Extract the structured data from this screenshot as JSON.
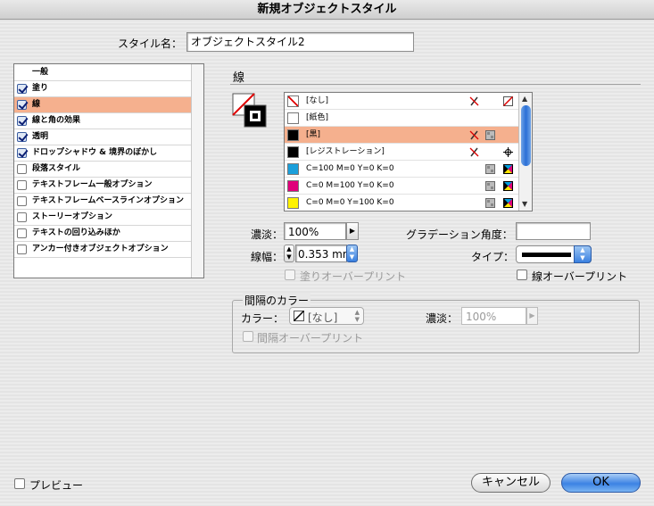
{
  "window": {
    "title": "新規オブジェクトスタイル"
  },
  "style_name": {
    "label": "スタイル名：",
    "value": "オブジェクトスタイル2"
  },
  "sidebar": {
    "items": [
      {
        "label": "一般",
        "checkbox": false,
        "checked": false,
        "selected": false
      },
      {
        "label": "塗り",
        "checkbox": true,
        "checked": true,
        "selected": false
      },
      {
        "label": "線",
        "checkbox": true,
        "checked": true,
        "selected": true
      },
      {
        "label": "線と角の効果",
        "checkbox": true,
        "checked": true,
        "selected": false
      },
      {
        "label": "透明",
        "checkbox": true,
        "checked": true,
        "selected": false
      },
      {
        "label": "ドロップシャドウ & 境界のぼかし",
        "checkbox": true,
        "checked": true,
        "selected": false
      },
      {
        "label": "段落スタイル",
        "checkbox": true,
        "checked": false,
        "selected": false
      },
      {
        "label": "テキストフレーム一般オプション",
        "checkbox": true,
        "checked": false,
        "selected": false
      },
      {
        "label": "テキストフレームベースラインオプション",
        "checkbox": true,
        "checked": false,
        "selected": false
      },
      {
        "label": "ストーリーオプション",
        "checkbox": true,
        "checked": false,
        "selected": false
      },
      {
        "label": "テキストの回り込みほか",
        "checkbox": true,
        "checked": false,
        "selected": false
      },
      {
        "label": "アンカー付きオブジェクトオプション",
        "checkbox": true,
        "checked": false,
        "selected": false
      }
    ]
  },
  "section": {
    "title": "線"
  },
  "swatches": [
    {
      "name": "[なし]",
      "color": "none",
      "selected": false
    },
    {
      "name": "[紙色]",
      "color": "#ffffff",
      "selected": false
    },
    {
      "name": "[黒]",
      "color": "#000000",
      "selected": true
    },
    {
      "name": "[レジストレーション]",
      "color": "#000000",
      "selected": false
    },
    {
      "name": "C=100 M=0 Y=0 K=0",
      "color": "#1a9fdb",
      "selected": false
    },
    {
      "name": "C=0 M=100 Y=0 K=0",
      "color": "#e0007a",
      "selected": false
    },
    {
      "name": "C=0 M=0 Y=100 K=0",
      "color": "#fff200",
      "selected": false
    }
  ],
  "tint": {
    "label": "濃淡：",
    "value": "100%"
  },
  "gradient_angle": {
    "label": "グラデーション角度：",
    "value": ""
  },
  "weight": {
    "label": "線幅：",
    "value": "0.353 mm"
  },
  "type": {
    "label": "タイプ："
  },
  "fill_overprint": {
    "label": "塗りオーバープリント",
    "checked": false
  },
  "stroke_overprint": {
    "label": "線オーバープリント",
    "checked": false
  },
  "gap": {
    "title": "間隔のカラー",
    "color_label": "カラー：",
    "color_value": "[なし]",
    "tint_label": "濃淡：",
    "tint_value": "100%",
    "overprint_label": "間隔オーバープリント"
  },
  "preview": {
    "label": "プレビュー",
    "checked": false
  },
  "buttons": {
    "cancel": "キャンセル",
    "ok": "OK"
  }
}
